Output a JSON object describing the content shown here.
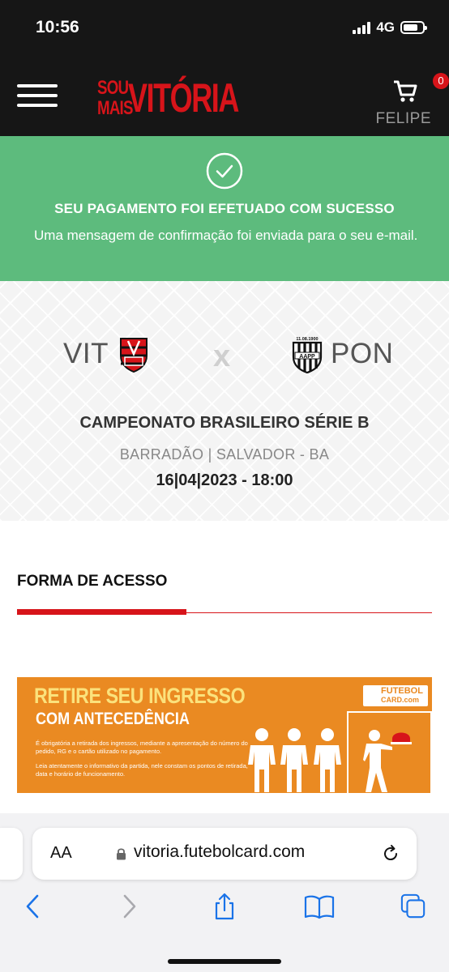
{
  "status_bar": {
    "time": "10:56",
    "network": "4G"
  },
  "header": {
    "logo": {
      "line1": "SOU",
      "line2": "MAIS",
      "main": "VITÓRIA"
    },
    "cart_count": "0",
    "user_name": "FELIPE"
  },
  "success": {
    "title": "SEU PAGAMENTO FOI EFETUADO COM SUCESSO",
    "message": "Uma mensagem de confirmação foi enviada para o seu e-mail."
  },
  "match": {
    "home_team": "VIT",
    "away_team": "PON",
    "separator": "x",
    "away_crest_date": "11.08.1900",
    "away_crest_letters": "AAPP",
    "competition": "CAMPEONATO BRASILEIRO SÉRIE B",
    "venue": "BARRADÃO | SALVADOR - BA",
    "datetime": "16|04|2023 - 18:00"
  },
  "access": {
    "title": "FORMA DE ACESSO"
  },
  "promo": {
    "title_line1": "RETIRE SEU INGRESSO",
    "title_line2": "COM ANTECEDÊNCIA",
    "note1": "É obrigatória a retirada dos ingressos, mediante a apresentação do número do pedido, RG e o cartão utilizado no pagamento.",
    "note2": "Leia atentamente o informativo da partida, nele constam os pontos de retirada, data e horário de funcionamento.",
    "logo_line1": "FUTEBOL",
    "logo_line2": "CARD.com"
  },
  "browser": {
    "text_size_label": "AA",
    "url": "vitoria.futebolcard.com",
    "toolbar": [
      "back-icon",
      "forward-icon",
      "share-icon",
      "bookmarks-icon",
      "tabs-icon"
    ]
  },
  "colors": {
    "brand_red": "#d7141a",
    "success_green": "#5dbb7d",
    "promo_orange": "#ea8a22",
    "ios_blue": "#1a73e8"
  }
}
